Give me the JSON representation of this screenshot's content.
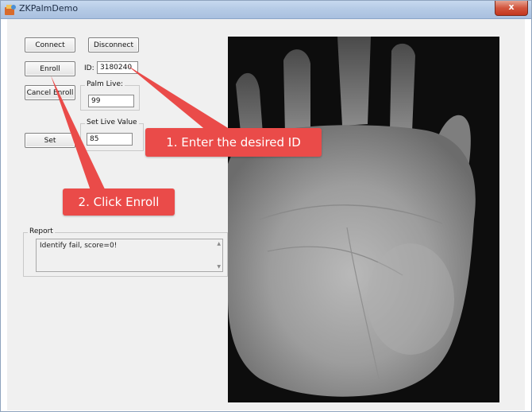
{
  "window": {
    "title": "ZKPalmDemo",
    "close_glyph": "x"
  },
  "buttons": {
    "connect": "Connect",
    "disconnect": "Disconnect",
    "enroll": "Enroll",
    "cancel_enroll": "Cancel Enroll",
    "set": "Set"
  },
  "fields": {
    "id_label": "ID:",
    "id_value": "3180240",
    "palm_live_label": "Palm Live:",
    "palm_live_value": "99",
    "set_live_label": "Set Live Value",
    "set_live_value": "85"
  },
  "report": {
    "label": "Report",
    "text": "Identify fail, score=0!"
  },
  "annotations": {
    "step1": "1. Enter the desired ID",
    "step2": "2. Click Enroll"
  },
  "colors": {
    "annotation": "#ea4b49",
    "titlebar": "#b6cbe6",
    "close_button": "#d2553d"
  },
  "icons": {
    "app": "palm-app-icon",
    "close": "close-icon"
  }
}
